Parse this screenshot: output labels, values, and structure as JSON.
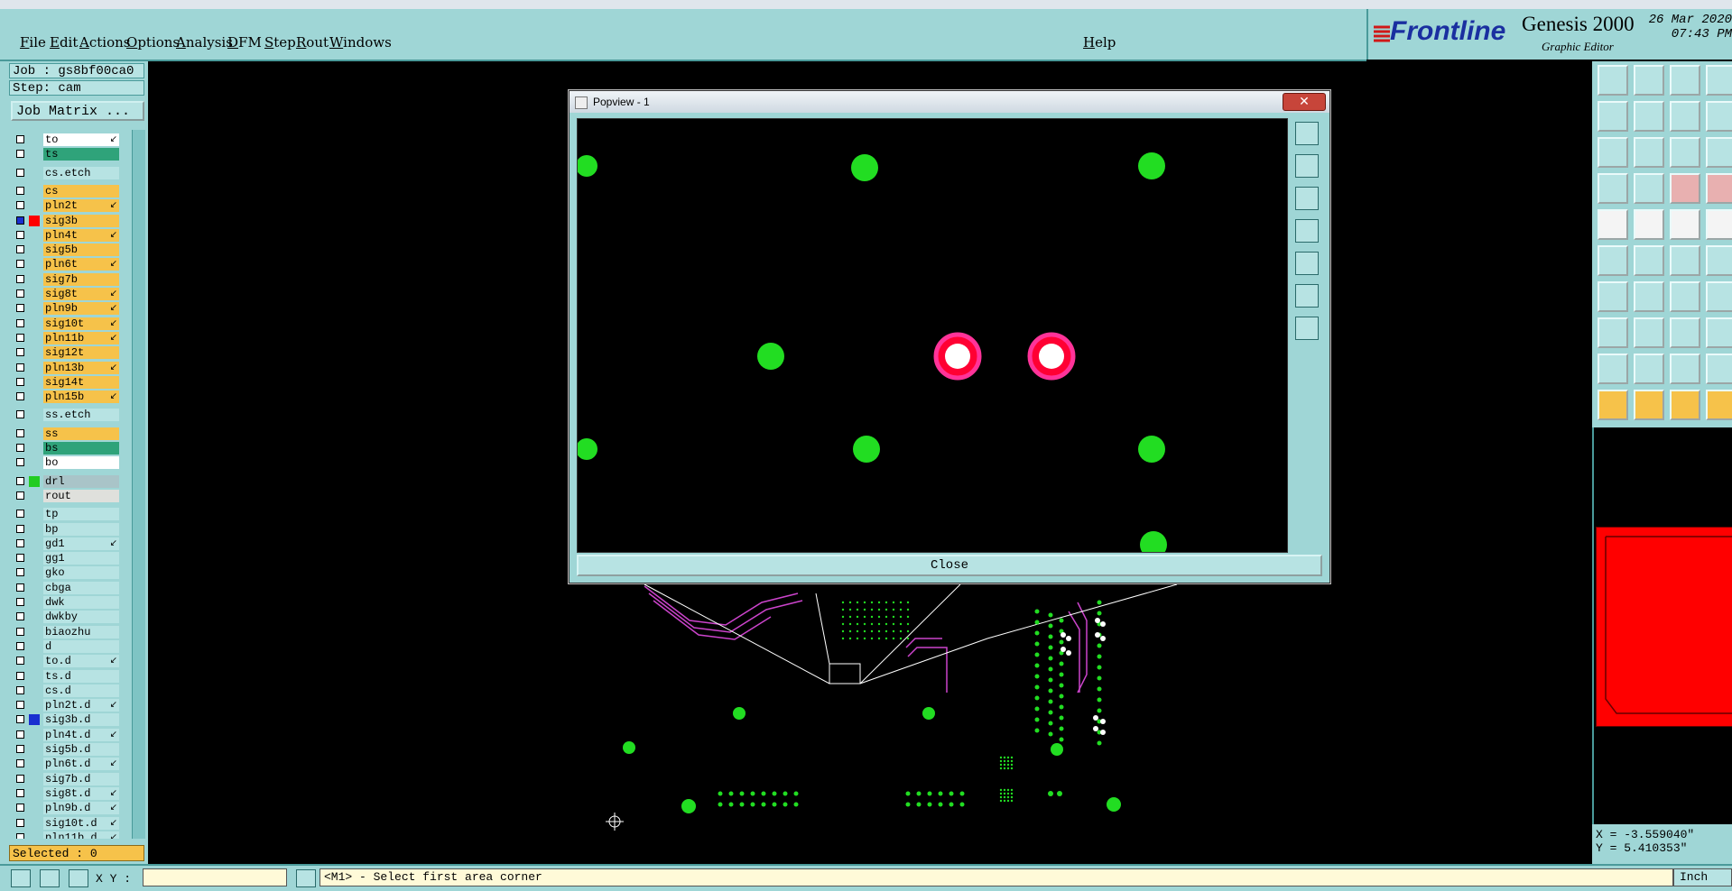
{
  "menubar": {
    "items": [
      "File",
      "Edit",
      "Actions",
      "Options",
      "Analysis",
      "DFM",
      "Step",
      "Rout",
      "Windows"
    ],
    "help": "Help"
  },
  "brand": {
    "logo": "Frontline",
    "product": "Genesis 2000",
    "subtitle": "Graphic Editor",
    "date": "26 Mar 2020",
    "time": "07:43 PM"
  },
  "job": {
    "job_label": "Job : gs8bf00ca0",
    "step_label": "Step: cam",
    "matrix_button": "Job Matrix ..."
  },
  "layers": [
    {
      "name": "to",
      "color": "#ffffff",
      "arrow": true
    },
    {
      "name": "ts",
      "color": "#2fa37a",
      "arrow": false
    },
    {
      "name": "cs.etch",
      "color": "#b7e3e3",
      "arrow": false
    },
    {
      "name": "cs",
      "color": "#f6c24a",
      "arrow": false
    },
    {
      "name": "pln2t",
      "color": "#f6c24a",
      "arrow": true
    },
    {
      "name": "sig3b",
      "color": "#f6c24a",
      "arrow": false,
      "active": true
    },
    {
      "name": "pln4t",
      "color": "#f6c24a",
      "arrow": true
    },
    {
      "name": "sig5b",
      "color": "#f6c24a",
      "arrow": false
    },
    {
      "name": "pln6t",
      "color": "#f6c24a",
      "arrow": true
    },
    {
      "name": "sig7b",
      "color": "#f6c24a",
      "arrow": false
    },
    {
      "name": "sig8t",
      "color": "#f6c24a",
      "arrow": true
    },
    {
      "name": "pln9b",
      "color": "#f6c24a",
      "arrow": true
    },
    {
      "name": "sig10t",
      "color": "#f6c24a",
      "arrow": true
    },
    {
      "name": "pln11b",
      "color": "#f6c24a",
      "arrow": true
    },
    {
      "name": "sig12t",
      "color": "#f6c24a",
      "arrow": false
    },
    {
      "name": "pln13b",
      "color": "#f6c24a",
      "arrow": true
    },
    {
      "name": "sig14t",
      "color": "#f6c24a",
      "arrow": false
    },
    {
      "name": "pln15b",
      "color": "#f6c24a",
      "arrow": true
    },
    {
      "name": "ss.etch",
      "color": "#b7e3e3",
      "arrow": false
    },
    {
      "name": "ss",
      "color": "#f6c24a",
      "arrow": false
    },
    {
      "name": "bs",
      "color": "#2fa37a",
      "arrow": false
    },
    {
      "name": "bo",
      "color": "#ffffff",
      "arrow": false
    },
    {
      "name": "drl",
      "color": "#a9c4c8",
      "arrow": false,
      "swatch": "#22cc22"
    },
    {
      "name": "rout",
      "color": "#dfe0dc",
      "arrow": false
    },
    {
      "name": "tp",
      "color": "#b7e3e3",
      "arrow": false
    },
    {
      "name": "bp",
      "color": "#b7e3e3",
      "arrow": false
    },
    {
      "name": "gd1",
      "color": "#b7e3e3",
      "arrow": true
    },
    {
      "name": "gg1",
      "color": "#b7e3e3",
      "arrow": false
    },
    {
      "name": "gko",
      "color": "#b7e3e3",
      "arrow": false
    },
    {
      "name": "cbga",
      "color": "#b7e3e3",
      "arrow": false
    },
    {
      "name": "dwk",
      "color": "#b7e3e3",
      "arrow": false
    },
    {
      "name": "dwkby",
      "color": "#b7e3e3",
      "arrow": false
    },
    {
      "name": "biaozhu",
      "color": "#b7e3e3",
      "arrow": false
    },
    {
      "name": "d",
      "color": "#b7e3e3",
      "arrow": false
    },
    {
      "name": "to.d",
      "color": "#b7e3e3",
      "arrow": true
    },
    {
      "name": "ts.d",
      "color": "#b7e3e3",
      "arrow": false
    },
    {
      "name": "cs.d",
      "color": "#b7e3e3",
      "arrow": false
    },
    {
      "name": "pln2t.d",
      "color": "#b7e3e3",
      "arrow": true
    },
    {
      "name": "sig3b.d",
      "color": "#b7e3e3",
      "arrow": false,
      "swatch": "#1a2fd0"
    },
    {
      "name": "pln4t.d",
      "color": "#b7e3e3",
      "arrow": true
    },
    {
      "name": "sig5b.d",
      "color": "#b7e3e3",
      "arrow": false
    },
    {
      "name": "pln6t.d",
      "color": "#b7e3e3",
      "arrow": true
    },
    {
      "name": "sig7b.d",
      "color": "#b7e3e3",
      "arrow": false
    },
    {
      "name": "sig8t.d",
      "color": "#b7e3e3",
      "arrow": true
    },
    {
      "name": "pln9b.d",
      "color": "#b7e3e3",
      "arrow": true
    },
    {
      "name": "sig10t.d",
      "color": "#b7e3e3",
      "arrow": true
    },
    {
      "name": "pln11b.d",
      "color": "#b7e3e3",
      "arrow": true
    }
  ],
  "selected": "Selected : 0",
  "popview": {
    "title": "Popview - 1",
    "close_x": "✕",
    "close_button": "Close"
  },
  "coords": {
    "x": "X = -3.559040\"",
    "y": "Y = 5.410353\""
  },
  "bottom": {
    "xy_label": "X Y :",
    "xy_value": "",
    "status": "<M1> - Select first area corner",
    "units": "Inch"
  },
  "colors": {
    "panel": "#9fd6d6",
    "pad_green": "#22dd22",
    "via_red": "#ff0033",
    "trace_magenta": "#cc44cc"
  }
}
